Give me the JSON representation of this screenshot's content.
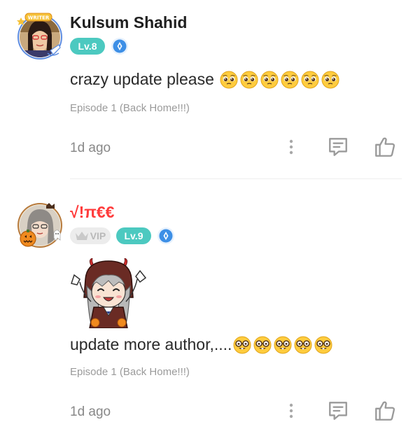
{
  "comments": [
    {
      "username": "Kulsum Shahid",
      "avatar_frame_label": "WRITER",
      "level": "Lv.8",
      "text": "crazy update please",
      "emoji": "pleading-face",
      "emoji_count": 6,
      "episode": "Episode 1 (Back Home!!!)",
      "time": "1d ago"
    },
    {
      "username": "√!π€€",
      "username_color": "#ff3b3b",
      "vip_label": "VIP",
      "level": "Lv.9",
      "sticker": "devil-girl-sticker",
      "text": "update more author,....",
      "emoji": "nerd-face",
      "emoji_count": 5,
      "episode": "Episode 1 (Back Home!!!)",
      "time": "1d ago"
    }
  ],
  "colors": {
    "level_badge": "#4cc9c0",
    "vip_badge_bg": "#ececec",
    "shield_badge": "#3d8fe6",
    "meta_text": "#9a9a9a"
  }
}
